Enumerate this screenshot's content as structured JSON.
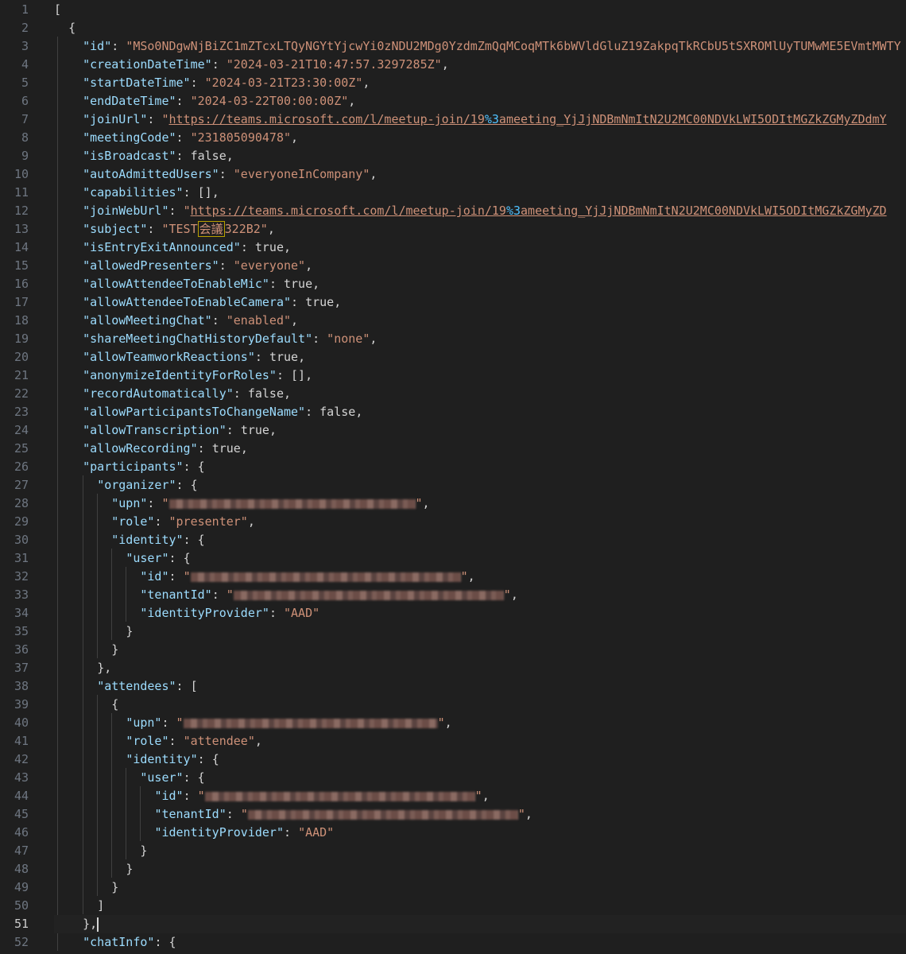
{
  "editor": {
    "active_line": 51,
    "line_numbers": [
      "1",
      "2",
      "3",
      "4",
      "5",
      "6",
      "7",
      "8",
      "9",
      "10",
      "11",
      "12",
      "13",
      "14",
      "15",
      "16",
      "17",
      "18",
      "19",
      "20",
      "21",
      "22",
      "23",
      "24",
      "25",
      "26",
      "27",
      "28",
      "29",
      "30",
      "31",
      "32",
      "33",
      "34",
      "35",
      "36",
      "37",
      "38",
      "39",
      "40",
      "41",
      "42",
      "43",
      "44",
      "45",
      "46",
      "47",
      "48",
      "49",
      "50",
      "51",
      "52"
    ],
    "tokens": {
      "open_bracket": "[",
      "open_brace": "{",
      "id_key": "\"id\"",
      "id_val": "\"MSo0NDgwNjBiZC1mZTcxLTQyNGYtYjcwYi0zNDU2MDg0YzdmZmQqMCoqMTk6bWVldGluZ19ZakpqTkRCbU5tSXROMlUyTUMwME5EVmtMWTY",
      "creationDateTime_key": "\"creationDateTime\"",
      "creationDateTime_val": "\"2024-03-21T10:47:57.3297285Z\"",
      "startDateTime_key": "\"startDateTime\"",
      "startDateTime_val": "\"2024-03-21T23:30:00Z\"",
      "endDateTime_key": "\"endDateTime\"",
      "endDateTime_val": "\"2024-03-22T00:00:00Z\"",
      "joinUrl_key": "\"joinUrl\"",
      "joinUrl_val_a": "https://teams.microsoft.com/l/meetup-join/19",
      "joinUrl_val_esc": "%3",
      "joinUrl_val_b": "ameeting_YjJjNDBmNmItN2U2MC00NDVkLWI5ODItMGZkZGMyZDdmY",
      "meetingCode_key": "\"meetingCode\"",
      "meetingCode_val": "\"231805090478\"",
      "isBroadcast_key": "\"isBroadcast\"",
      "isBroadcast_val": "false",
      "autoAdmittedUsers_key": "\"autoAdmittedUsers\"",
      "autoAdmittedUsers_val": "\"everyoneInCompany\"",
      "capabilities_key": "\"capabilities\"",
      "capabilities_val": "[]",
      "joinWebUrl_key": "\"joinWebUrl\"",
      "joinWebUrl_val_a": "https://teams.microsoft.com/l/meetup-join/19",
      "joinWebUrl_val_esc": "%3",
      "joinWebUrl_val_b": "ameeting_YjJjNDBmNmItN2U2MC00NDVkLWI5ODItMGZkZGMyZD",
      "subject_key": "\"subject\"",
      "subject_val_a": "\"TEST",
      "subject_val_cjk": "会議",
      "subject_val_b": "322B2\"",
      "isEntryExitAnnounced_key": "\"isEntryExitAnnounced\"",
      "allowedPresenters_key": "\"allowedPresenters\"",
      "allowedPresenters_val": "\"everyone\"",
      "allowAttendeeToEnableMic_key": "\"allowAttendeeToEnableMic\"",
      "allowAttendeeToEnableCamera_key": "\"allowAttendeeToEnableCamera\"",
      "allowMeetingChat_key": "\"allowMeetingChat\"",
      "allowMeetingChat_val": "\"enabled\"",
      "shareMeetingChatHistoryDefault_key": "\"shareMeetingChatHistoryDefault\"",
      "shareMeetingChatHistoryDefault_val": "\"none\"",
      "allowTeamworkReactions_key": "\"allowTeamworkReactions\"",
      "anonymizeIdentityForRoles_key": "\"anonymizeIdentityForRoles\"",
      "recordAutomatically_key": "\"recordAutomatically\"",
      "allowParticipantsToChangeName_key": "\"allowParticipantsToChangeName\"",
      "allowTranscription_key": "\"allowTranscription\"",
      "allowRecording_key": "\"allowRecording\"",
      "participants_key": "\"participants\"",
      "organizer_key": "\"organizer\"",
      "upn_key": "\"upn\"",
      "role_key": "\"role\"",
      "role_presenter": "\"presenter\"",
      "role_attendee": "\"attendee\"",
      "identity_key": "\"identity\"",
      "user_key": "\"user\"",
      "tenantId_key": "\"tenantId\"",
      "identityProvider_key": "\"identityProvider\"",
      "identityProvider_val": "\"AAD\"",
      "attendees_key": "\"attendees\"",
      "chatInfo_key": "\"chatInfo\"",
      "true": "true",
      "false": "false",
      "quote": "\"",
      "colon": ": ",
      "comma": ",",
      "close_brace": "}",
      "close_brace_comma": "},",
      "close_bracket": "]",
      "open_bracket_sp": "["
    }
  }
}
